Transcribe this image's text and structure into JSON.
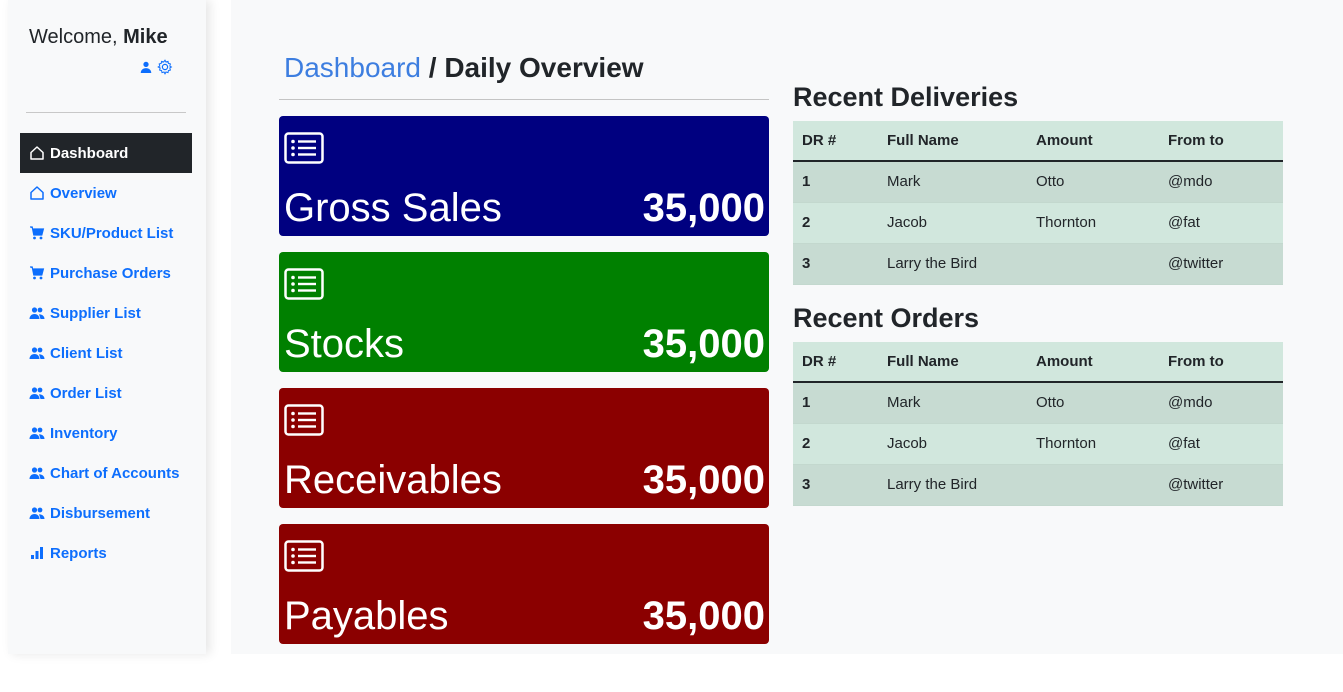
{
  "sidebar": {
    "welcome_prefix": "Welcome,",
    "user_name": "Mike",
    "nav": [
      {
        "label": "Dashboard",
        "icon": "home-icon",
        "active": true
      },
      {
        "label": "Overview",
        "icon": "home-icon"
      },
      {
        "label": "SKU/Product List",
        "icon": "cart-icon"
      },
      {
        "label": "Purchase Orders",
        "icon": "cart-icon"
      },
      {
        "label": "Supplier List",
        "icon": "people-icon"
      },
      {
        "label": "Client List",
        "icon": "people-icon"
      },
      {
        "label": "Order List",
        "icon": "people-icon"
      },
      {
        "label": "Inventory",
        "icon": "people-icon"
      },
      {
        "label": "Chart of Accounts",
        "icon": "people-icon"
      },
      {
        "label": "Disbursement",
        "icon": "people-icon"
      },
      {
        "label": "Reports",
        "icon": "bar-chart-icon"
      }
    ]
  },
  "header": {
    "breadcrumb": "Dashboard",
    "separator": "/",
    "page_title": "Daily Overview"
  },
  "cards": [
    {
      "label": "Gross Sales",
      "value": "35,000",
      "color": "#000080",
      "icon": "list-icon"
    },
    {
      "label": "Stocks",
      "value": "35,000",
      "color": "#008000",
      "icon": "list-icon"
    },
    {
      "label": "Receivables",
      "value": "35,000",
      "color": "#8b0000",
      "icon": "list-icon"
    },
    {
      "label": "Payables",
      "value": "35,000",
      "color": "#8b0000",
      "icon": "list-icon"
    }
  ],
  "deliveries": {
    "title": "Recent Deliveries",
    "columns": [
      "DR #",
      "Full Name",
      "Amount",
      "From to"
    ],
    "rows": [
      [
        "1",
        "Mark",
        "Otto",
        "@mdo"
      ],
      [
        "2",
        "Jacob",
        "Thornton",
        "@fat"
      ],
      [
        "3",
        "Larry the Bird",
        "",
        "@twitter"
      ]
    ]
  },
  "orders": {
    "title": "Recent Orders",
    "columns": [
      "DR #",
      "Full Name",
      "Amount",
      "From to"
    ],
    "rows": [
      [
        "1",
        "Mark",
        "Otto",
        "@mdo"
      ],
      [
        "2",
        "Jacob",
        "Thornton",
        "@fat"
      ],
      [
        "3",
        "Larry the Bird",
        "",
        "@twitter"
      ]
    ]
  },
  "colors": {
    "accent": "#0d6efd",
    "active_nav_bg": "#212529",
    "table_bg": "#d1e7dd"
  }
}
